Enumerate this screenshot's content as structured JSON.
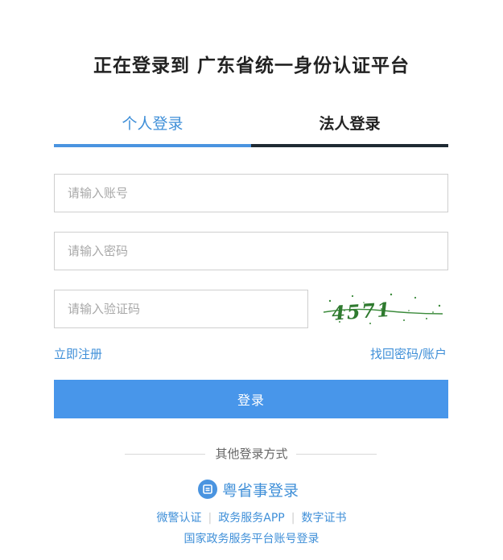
{
  "header": {
    "title": "正在登录到 广东省统一身份认证平台"
  },
  "tabs": [
    {
      "label": "个人登录",
      "active": true
    },
    {
      "label": "法人登录",
      "active": false
    }
  ],
  "form": {
    "account_placeholder": "请输入账号",
    "password_placeholder": "请输入密码",
    "captcha_placeholder": "请输入验证码",
    "captcha_text": "4571",
    "register_label": "立即注册",
    "forgot_label": "找回密码/账户",
    "login_label": "登录"
  },
  "other": {
    "heading": "其他登录方式",
    "yss_label": "粤省事登录",
    "links": [
      "微警认证",
      "政务服务APP",
      "数字证书"
    ],
    "national_label": "国家政务服务平台账号登录"
  },
  "colors": {
    "accent": "#4896ea",
    "link": "#3f8fd8",
    "tab_inactive_bar": "#1f2a33",
    "captcha_green": "#2f7a2f"
  }
}
